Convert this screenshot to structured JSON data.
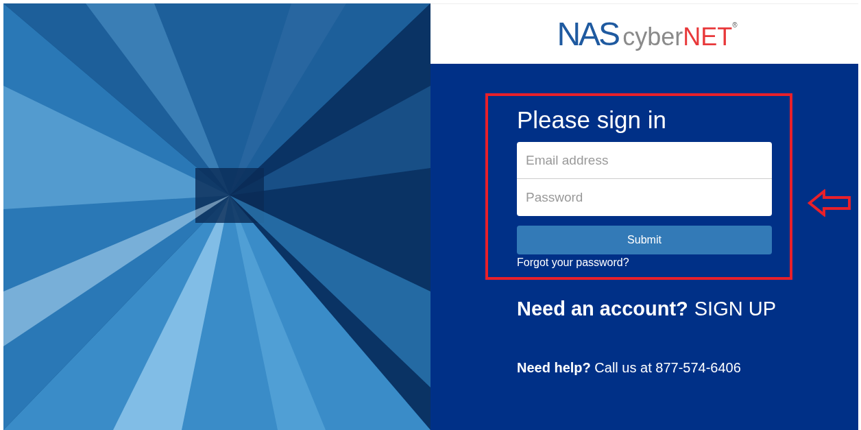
{
  "logo": {
    "mark": "NAS",
    "word": "cyber",
    "accent": "NET",
    "registered": "®"
  },
  "form": {
    "title": "Please sign in",
    "fields": [
      {
        "placeholder": "Email address"
      },
      {
        "placeholder": "Password"
      }
    ],
    "submit": "Submit",
    "forgot_link": "Forgot your password?"
  },
  "account": {
    "prompt": "Need an account?",
    "link": "SIGN UP"
  },
  "help": "**Need help?** Call us at 877-574-6406"
}
